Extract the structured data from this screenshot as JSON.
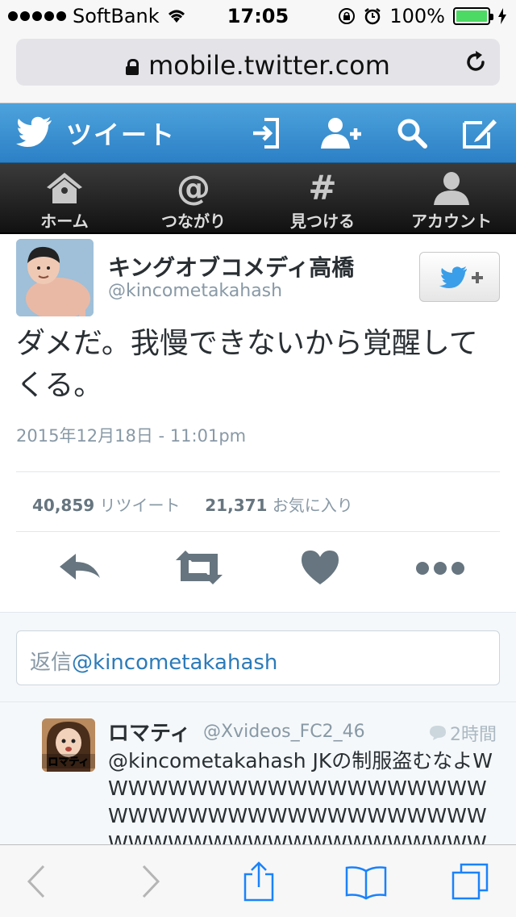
{
  "status_bar": {
    "carrier": "SoftBank",
    "time": "17:05",
    "battery": "100%",
    "signal_bars": 5,
    "battery_level": 1.0
  },
  "browser": {
    "url": "mobile.twitter.com"
  },
  "twitter_header": {
    "title": "ツイート"
  },
  "nav": {
    "items": [
      {
        "label": "ホーム",
        "icon": "home-icon"
      },
      {
        "label": "つながり",
        "icon": "at-icon"
      },
      {
        "label": "見つける",
        "icon": "hash-icon"
      },
      {
        "label": "アカウント",
        "icon": "person-icon"
      }
    ]
  },
  "tweet": {
    "author_name": "キングオブコメディ高橋",
    "author_handle": "@kincometakahash",
    "text": "ダメだ。我慢できないから覚醒してくる。",
    "timestamp": "2015年12月18日 - 11:01pm",
    "retweet_count": "40,859",
    "retweet_label": "リツイート",
    "favorite_count": "21,371",
    "favorite_label": "お気に入り"
  },
  "reply_box": {
    "prefix": "返信",
    "mention": "@kincometakahash"
  },
  "reply": {
    "author_name": "ロマティ",
    "author_handle": "@Xvideos_FC2_46",
    "time": "2時間",
    "avatar_label": "ロマティ",
    "text": "@kincometakahash JKの制服盗むなよWWWWWWWWWWWWWWWWWWWWWWWWWWWWWWWWWWWWWWWWWWWWWWWWWWWWWWWWWWWWWWWWWWWWWWWWWW"
  },
  "colors": {
    "twitter_blue": "#3a8fd3",
    "nav_dark": "#222222",
    "link": "#2b7bb9",
    "safari_blue": "#1a82fb",
    "battery_green": "#4cd964"
  }
}
